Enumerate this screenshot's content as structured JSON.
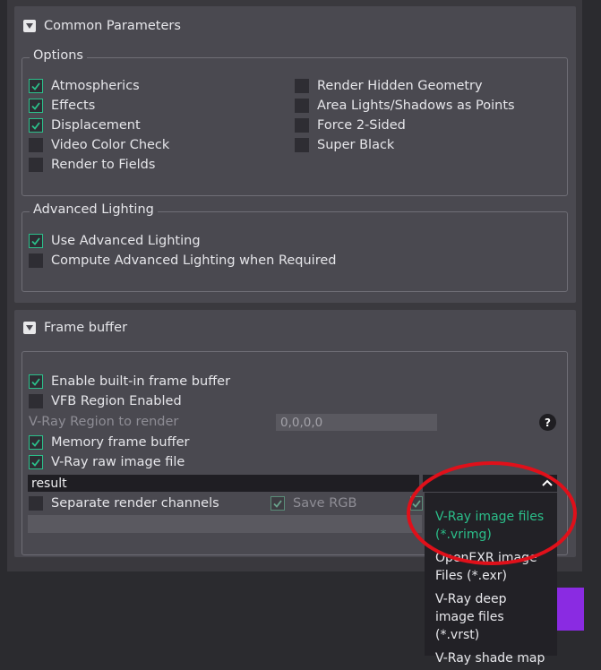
{
  "common": {
    "title": "Common Parameters",
    "options_legend": "Options",
    "options_left": [
      {
        "label": "Atmospherics",
        "checked": true
      },
      {
        "label": "Effects",
        "checked": true
      },
      {
        "label": "Displacement",
        "checked": true
      },
      {
        "label": "Video Color Check",
        "checked": false
      },
      {
        "label": "Render to Fields",
        "checked": false
      }
    ],
    "options_right": [
      {
        "label": "Render Hidden Geometry",
        "checked": false
      },
      {
        "label": "Area Lights/Shadows as Points",
        "checked": false
      },
      {
        "label": "Force 2-Sided",
        "checked": false
      },
      {
        "label": "Super Black",
        "checked": false
      }
    ],
    "adv_legend": "Advanced Lighting",
    "adv_items": [
      {
        "label": "Use Advanced Lighting",
        "checked": true
      },
      {
        "label": "Compute Advanced Lighting when Required",
        "checked": false
      }
    ]
  },
  "frame": {
    "title": "Frame buffer",
    "enable_vfb": "Enable built-in frame buffer",
    "vfb_region": "VFB Region Enabled",
    "region_label": "V-Ray Region to render",
    "region_value": "0,0,0,0",
    "help": "?",
    "memory_fb": "Memory frame buffer",
    "raw_image": "V-Ray raw image file",
    "filename": "result",
    "separate": "Separate render channels",
    "save_rgb": "Save RGB"
  },
  "menu": {
    "items": [
      "V-Ray image files (*.vrimg)",
      "OpenEXR image Files (*.exr)",
      "V-Ray deep image files (*.vrst)",
      "V-Ray shade map"
    ]
  },
  "colors": {
    "accent": "#2bbf8a",
    "annotation": "#e0101a",
    "purple": "#8a2be2"
  }
}
